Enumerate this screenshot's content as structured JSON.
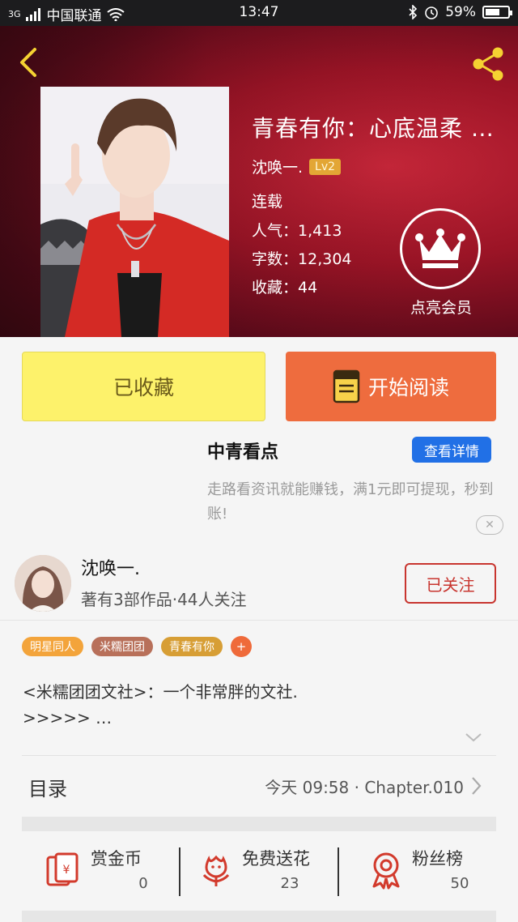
{
  "status_bar": {
    "network": "3G",
    "carrier": "中国联通",
    "time": "13:47",
    "battery": "59%"
  },
  "book": {
    "title": "青春有你：心底温柔 …",
    "author": "沈唤一.",
    "level": "Lv2",
    "status": "连载",
    "popularity_label": "人气：",
    "popularity": "1,413",
    "words_label": "字数：",
    "words": "12,304",
    "favorites_label": "收藏：",
    "favorites": "44",
    "vip_label": "点亮会员"
  },
  "actions": {
    "collected": "已收藏",
    "start_reading": "开始阅读"
  },
  "ad": {
    "title": "中青看点",
    "detail_button": "查看详情",
    "description": "走路看资讯就能赚钱，满1元即可提现，秒到账!"
  },
  "author_info": {
    "name": "沈唤一.",
    "subtitle": "著有3部作品·44人关注",
    "follow_button": "已关注"
  },
  "tags": [
    {
      "label": "明星同人",
      "color": "#f3a43b"
    },
    {
      "label": "米糯团团",
      "color": "#b8705a"
    },
    {
      "label": "青春有你",
      "color": "#d79e35"
    }
  ],
  "tag_add": "+",
  "description": {
    "line1": "<米糯团团文社>：一个非常胖的文社.",
    "line2": ">>>>> …"
  },
  "catalog": {
    "label": "目录",
    "update": "今天 09:58 · Chapter.010"
  },
  "rewards": [
    {
      "label": "赏金币",
      "value": "0",
      "icon": "red-envelope-icon"
    },
    {
      "label": "免费送花",
      "value": "23",
      "icon": "flower-icon"
    },
    {
      "label": "粉丝榜",
      "value": "50",
      "icon": "medal-icon"
    }
  ],
  "colors": {
    "accent_orange": "#ee6c3e",
    "collected_yellow": "#fdf26b",
    "follow_red": "#c8352f",
    "ad_blue": "#2170e6",
    "header_red": "#9c1426"
  }
}
